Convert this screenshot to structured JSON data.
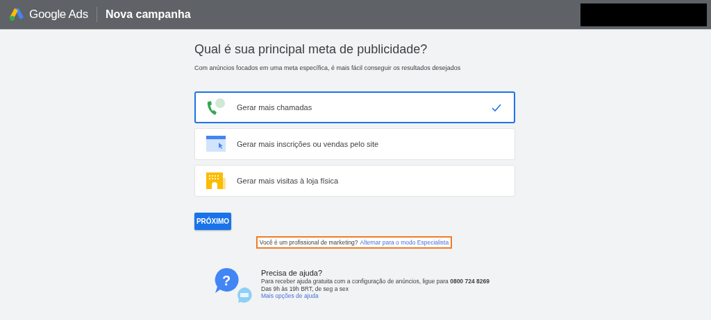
{
  "header": {
    "product": "Google Ads",
    "title": "Nova campanha"
  },
  "heading": "Qual é sua principal meta de publicidade?",
  "subtitle": "Com anúncios focados em uma meta específica, é mais fácil conseguir os resultados desejados",
  "options": [
    {
      "kind": "phone",
      "label": "Gerar mais chamadas",
      "selected": true
    },
    {
      "kind": "web",
      "label": "Gerar mais inscrições ou vendas pelo site",
      "selected": false
    },
    {
      "kind": "store",
      "label": "Gerar mais visitas à loja física",
      "selected": false
    }
  ],
  "next_button": "PRÓXIMO",
  "expert": {
    "question": "Você é um profissional de marketing?",
    "link": "Alternar para o modo Especialista"
  },
  "help": {
    "icon_glyph": "?",
    "title": "Precisa de ajuda?",
    "text": "Para receber ajuda gratuita com a configuração de anúncios, ligue para **0800 724 8269**",
    "hours": "Das 9h às 19h BRT, de seg a sex",
    "link": "Mais opções de ajuda"
  }
}
